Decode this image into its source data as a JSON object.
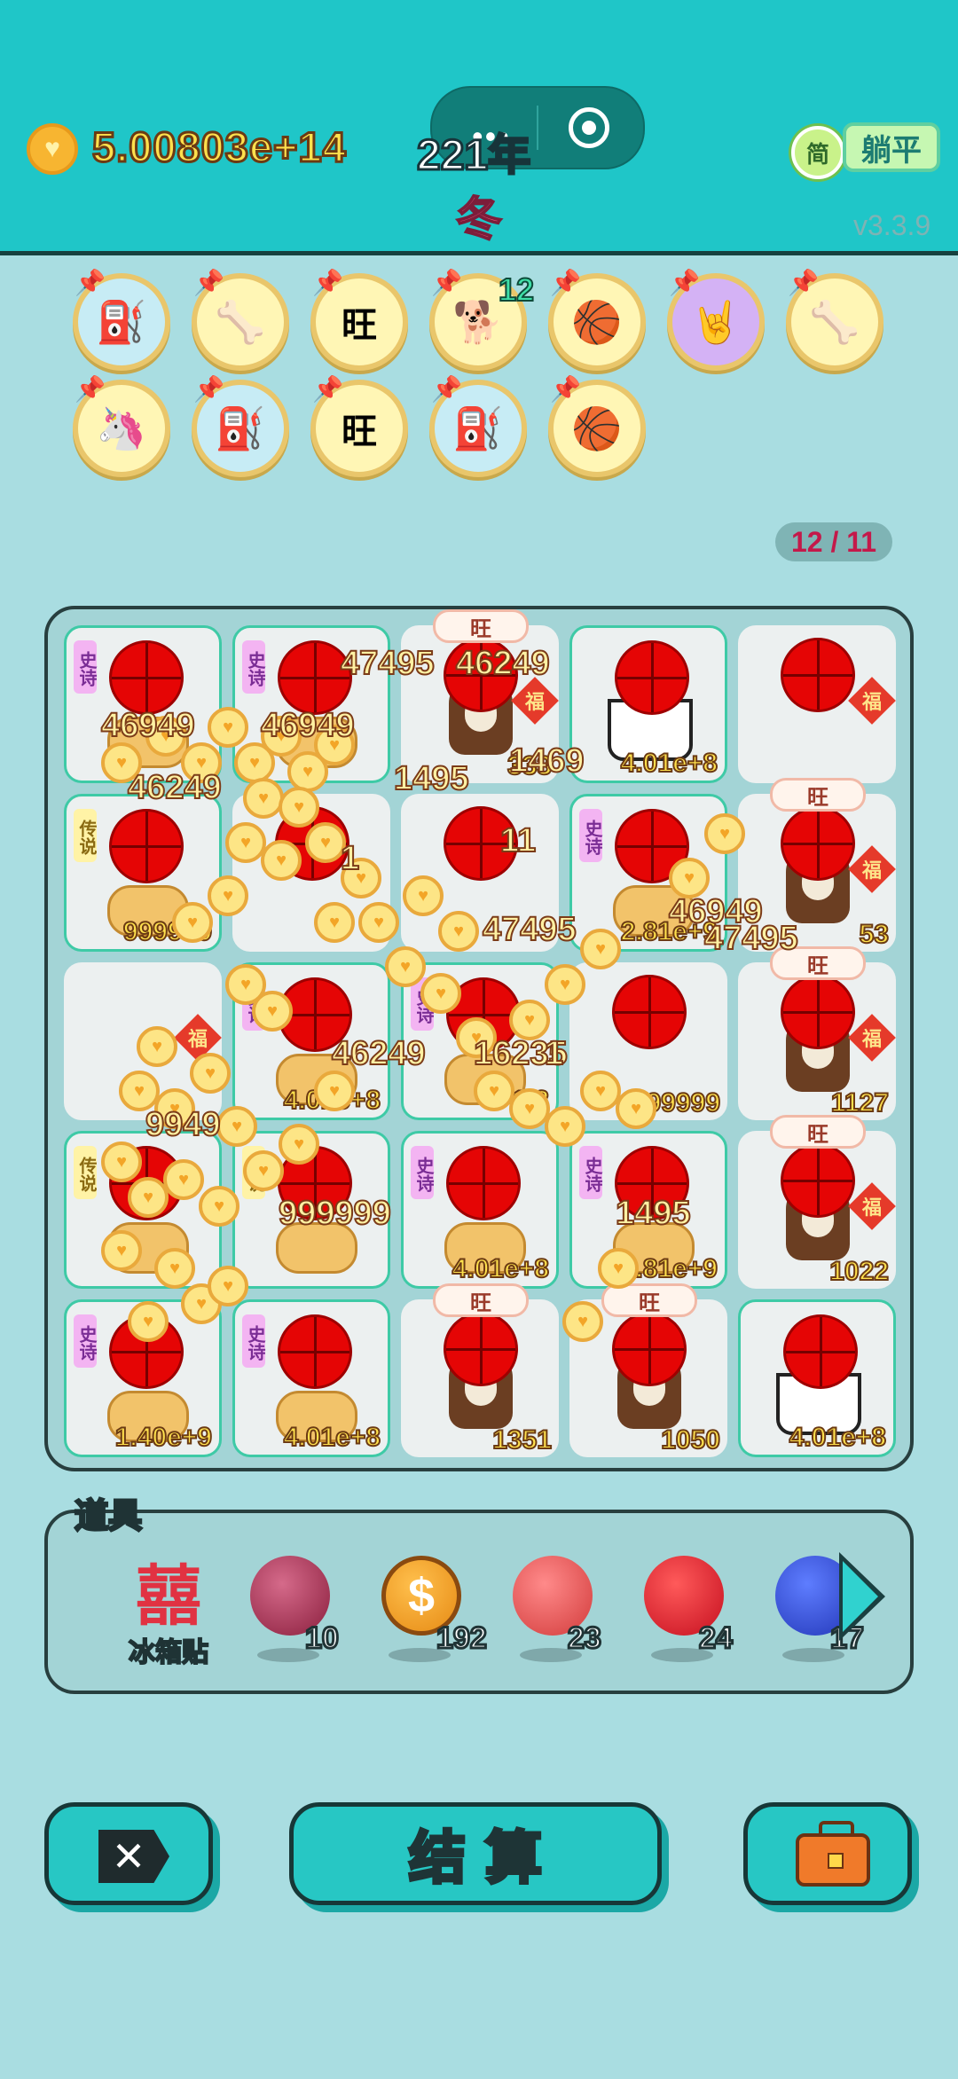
{
  "header": {
    "coin_icon": "heart-coin-icon",
    "coins": "5.00803e+14",
    "year": "221年",
    "season": "冬",
    "simplified": "简",
    "lie_flat": "躺平",
    "version": "v3.3.9"
  },
  "capsule": {
    "more_icon": "more-dots-icon",
    "close_icon": "target-close-icon"
  },
  "relics": [
    {
      "icon": "pump-icon"
    },
    {
      "icon": "dog-bowl-icon"
    },
    {
      "icon": "wang-tiles-icon"
    },
    {
      "icon": "husky-dog-icon",
      "count": "12"
    },
    {
      "icon": "basketballs-icon"
    },
    {
      "icon": "rock-hand-icon"
    },
    {
      "icon": "dog-bowl-icon"
    },
    {
      "icon": "unicorn-icon"
    },
    {
      "icon": "pump-icon"
    },
    {
      "icon": "wang-tiles-icon"
    },
    {
      "icon": "pump-icon"
    },
    {
      "icon": "basketballs-icon"
    }
  ],
  "counter": "12 / 11",
  "board": {
    "tag_epic": "史诗",
    "tag_legend": "传说",
    "fu": "福",
    "wang": "旺",
    "cells": [
      {
        "value": ""
      },
      {
        "value": ""
      },
      {
        "value": "333"
      },
      {
        "value": "4.01e+8"
      },
      {
        "value": ""
      },
      {
        "value": "999999"
      },
      {
        "value": ""
      },
      {
        "value": ""
      },
      {
        "value": "2.81e+9"
      },
      {
        "value": "53"
      },
      {
        "value": ""
      },
      {
        "value": "4.01e+8"
      },
      {
        "value": "1.2"
      },
      {
        "value": "999999"
      },
      {
        "value": "1127"
      },
      {
        "value": ""
      },
      {
        "value": ""
      },
      {
        "value": "4.01e+8"
      },
      {
        "value": "2.81e+9"
      },
      {
        "value": "1022"
      },
      {
        "value": "1.40e+9"
      },
      {
        "value": "4.01e+8"
      },
      {
        "value": "1351"
      },
      {
        "value": "1050"
      },
      {
        "value": "4.01e+8"
      }
    ],
    "floating": [
      "47495",
      "46949",
      "46249",
      "1495",
      "1",
      "11",
      "1469",
      "47495",
      "46949",
      "46249",
      "16235",
      "9949",
      "999999"
    ]
  },
  "items": {
    "title": "道具",
    "fridge_label": "冰箱贴",
    "fridge_icon": "囍",
    "list": [
      {
        "icon": "lychee-icon",
        "count": "10"
      },
      {
        "icon": "coin-dollar-icon",
        "count": "192"
      },
      {
        "icon": "liver-icon",
        "count": "23"
      },
      {
        "icon": "strawberry-icon",
        "count": "24"
      },
      {
        "icon": "blueberry-icon",
        "count": "17"
      }
    ],
    "next_icon": "arrow-right-icon"
  },
  "buttons": {
    "close_icon": "close-x-icon",
    "settle": "结算",
    "bag_icon": "briefcase-icon"
  },
  "colors": {
    "header_bg": "#1fc6c8",
    "page_bg": "#a9dde1",
    "coin_text": "#ffe14d",
    "season": "#ff5c83",
    "accent_red": "#e50505"
  }
}
